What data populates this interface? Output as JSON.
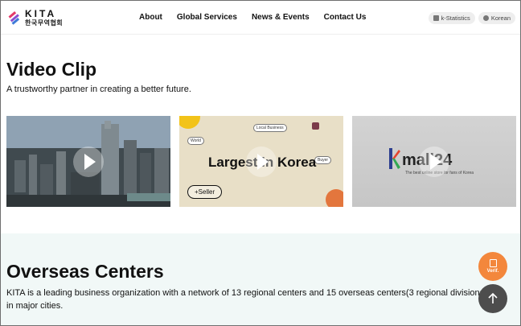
{
  "header": {
    "logo_en": "KITA",
    "logo_kr": "한국무역협회",
    "nav": [
      "About",
      "Global Services",
      "News & Events",
      "Contact Us"
    ],
    "utils": [
      {
        "label": "k-Statistics",
        "icon": "chart-icon"
      },
      {
        "label": "Korean",
        "icon": "globe-icon"
      }
    ]
  },
  "video": {
    "title": "Video Clip",
    "subtitle": "A trustworthy partner in creating a better future.",
    "clips": [
      {
        "name": "city-aerial"
      },
      {
        "name": "largest-in-korea",
        "headline": "Largest in Korea",
        "chip": "+Seller",
        "tags": [
          "Local Business",
          "World",
          "Buyer"
        ]
      },
      {
        "name": "kmall24",
        "headline": "mall24",
        "tagline": "The best online store for fans of Korea"
      }
    ]
  },
  "overseas": {
    "title": "Overseas Centers",
    "description": "KITA is a leading business organization with a network of 13 regional centers and 15 overseas centers(3 regional divisions) in major cities."
  },
  "fab": {
    "verif_label": "Verif."
  },
  "colors": {
    "accent_orange": "#f3873c",
    "section_bg": "#f1f8f7",
    "fab_dark": "#4d4d4d"
  }
}
